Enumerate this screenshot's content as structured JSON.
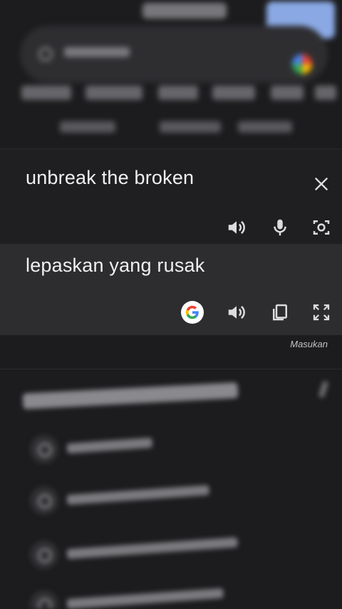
{
  "translator": {
    "source_text": "unbreak the broken",
    "translated_text": "lepaskan yang rusak",
    "feedback_label": "Masukan"
  },
  "icons": {
    "source_actions": [
      "speaker-icon",
      "microphone-icon",
      "camera-icon"
    ],
    "target_actions": [
      "google-logo-icon",
      "speaker-icon",
      "copy-icon",
      "fullscreen-icon"
    ],
    "close": "close-icon"
  },
  "colors": {
    "background": "#1c1c1e",
    "source_panel": "#1f1f21",
    "target_panel": "#2d2d30",
    "icon": "#dcdcdc",
    "google_blue": "#4285f4",
    "google_red": "#ea4335",
    "google_yellow": "#fbbc05",
    "google_green": "#34a853"
  }
}
